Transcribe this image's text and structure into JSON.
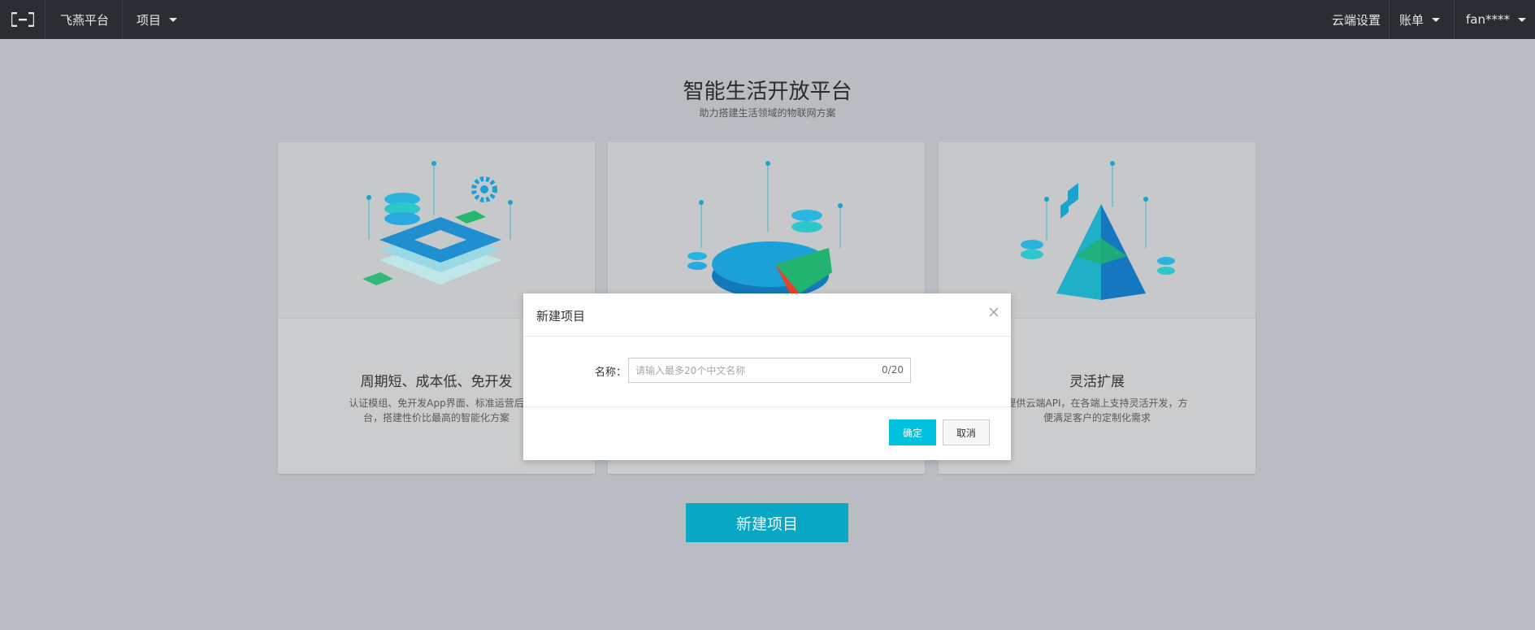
{
  "topbar": {
    "platform": "飞燕平台",
    "project_menu": "项目",
    "cloud_settings": "云端设置",
    "billing_menu": "账单",
    "user": "fan****"
  },
  "hero": {
    "title": "智能生活开放平台",
    "subtitle": "助力搭建生活领域的物联网方案"
  },
  "cards": [
    {
      "title": "周期短、成本低、免开发",
      "desc": "认证模组、免开发App界面、标准运营后台，搭建性价比最高的智能化方案"
    },
    {
      "title": "",
      "desc": ""
    },
    {
      "title": "灵活扩展",
      "desc": "提供云端API，在各端上支持灵活开发，方便满足客户的定制化需求"
    }
  ],
  "new_project_button": "新建项目",
  "modal": {
    "title": "新建项目",
    "name_label": "名称：",
    "name_placeholder": "请输入最多20个中文名称",
    "name_value": "",
    "char_count": "0/20",
    "ok": "确定",
    "cancel": "取消"
  },
  "colors": {
    "topbar": "#2a2e33",
    "primary": "#00c1de",
    "page_bg": "#b9bdc1"
  }
}
